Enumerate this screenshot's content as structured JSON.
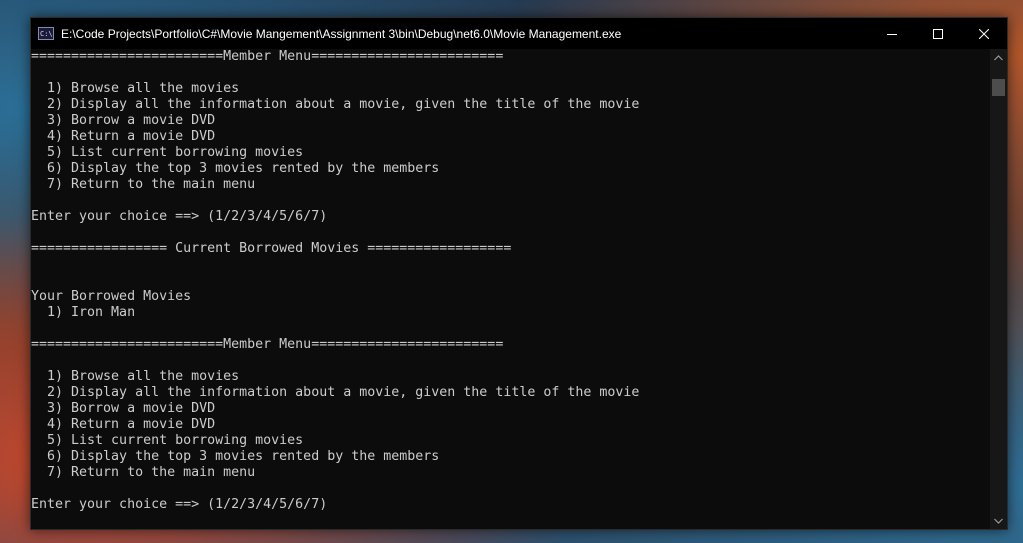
{
  "window": {
    "title": "E:\\Code Projects\\Portfolio\\C#\\Movie Mangement\\Assignment 3\\bin\\Debug\\net6.0\\Movie Management.exe",
    "icon_label": "C:\\"
  },
  "console": {
    "lines": [
      "========================Member Menu========================",
      "",
      "  1) Browse all the movies",
      "  2) Display all the information about a movie, given the title of the movie",
      "  3) Borrow a movie DVD",
      "  4) Return a movie DVD",
      "  5) List current borrowing movies",
      "  6) Display the top 3 movies rented by the members",
      "  7) Return to the main menu",
      "",
      "Enter your choice ==> (1/2/3/4/5/6/7)",
      "",
      "================= Current Borrowed Movies ==================",
      "",
      "",
      "Your Borrowed Movies",
      "  1) Iron Man",
      "",
      "========================Member Menu========================",
      "",
      "  1) Browse all the movies",
      "  2) Display all the information about a movie, given the title of the movie",
      "  3) Borrow a movie DVD",
      "  4) Return a movie DVD",
      "  5) List current borrowing movies",
      "  6) Display the top 3 movies rented by the members",
      "  7) Return to the main menu",
      "",
      "Enter your choice ==> (1/2/3/4/5/6/7)"
    ]
  },
  "colors": {
    "console_bg": "#0c0c0c",
    "console_text": "#cccccc",
    "titlebar_bg": "#000000"
  }
}
